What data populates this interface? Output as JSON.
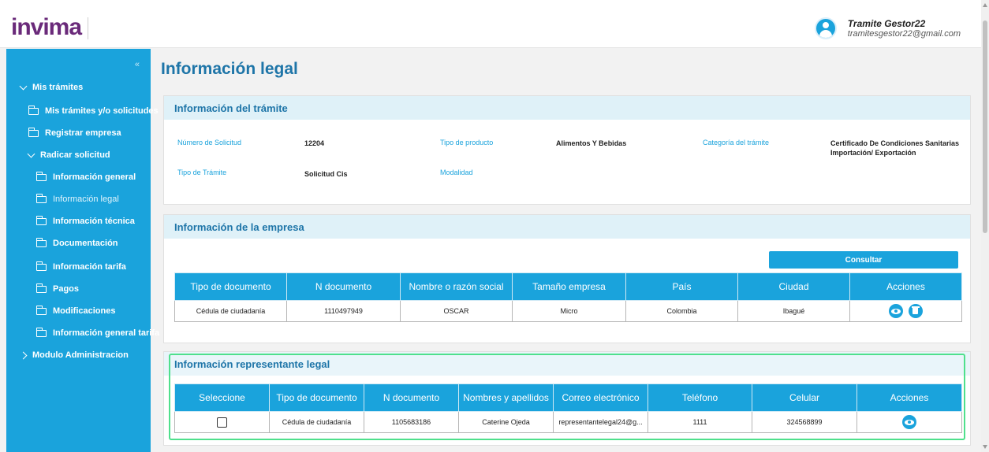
{
  "header": {
    "logo_text": "invima",
    "user_name": "Tramite Gestor22",
    "user_email": "tramitesgestor22@gmail.com"
  },
  "sidebar": {
    "collapse_icon": "double-chevron-left-icon",
    "items": [
      {
        "label": "Mis trámites"
      },
      {
        "label": "Mis trámites y/o solicitudes"
      },
      {
        "label": "Registrar empresa"
      },
      {
        "label": "Radicar solicitud"
      },
      {
        "label": "Información general"
      },
      {
        "label": "Información legal"
      },
      {
        "label": "Información técnica"
      },
      {
        "label": "Documentación"
      },
      {
        "label": "Información tarifa"
      },
      {
        "label": "Pagos"
      },
      {
        "label": "Modificaciones"
      },
      {
        "label": "Información general tarifa"
      },
      {
        "label": "Modulo Administracion"
      }
    ],
    "accent_color": "#1aa3dc"
  },
  "page": {
    "title": "Información legal"
  },
  "tramite": {
    "section_title": "Información del trámite",
    "numero_label": "Número de Solicitud",
    "numero_value": "12204",
    "tipo_producto_label": "Tipo de producto",
    "tipo_producto_value": "Alimentos Y Bebidas",
    "categoria_label": "Categoría del trámite",
    "categoria_value_line1": "Certificado De Condiciones Sanitarias",
    "categoria_value_line2": "Importación/ Exportación",
    "tipo_tramite_label": "Tipo de Trámite",
    "tipo_tramite_value": "Solicitud Cis",
    "modalidad_label": "Modalidad"
  },
  "empresa": {
    "section_title": "Información de la empresa",
    "consultar_label": "Consultar",
    "columns": [
      "Tipo de documento",
      "N documento",
      "Nombre o razón social",
      "Tamaño empresa",
      "País",
      "Ciudad",
      "Acciones"
    ],
    "rows": [
      {
        "tipo": "Cédula de ciudadanía",
        "numero": "1110497949",
        "nombre": "OSCAR",
        "tamano": "Micro",
        "pais": "Colombia",
        "ciudad": "Ibagué"
      }
    ]
  },
  "representante": {
    "section_title": "Información representante legal",
    "columns": [
      "Seleccione",
      "Tipo de documento",
      "N documento",
      "Nombres y apellidos",
      "Correo electrónico",
      "Teléfono",
      "Celular",
      "Acciones"
    ],
    "rows": [
      {
        "tipo": "Cédula de ciudadanía",
        "numero": "1105683186",
        "nombre": "Caterine Ojeda",
        "correo": "representantelegal24@g...",
        "telefono": "1111",
        "celular": "324568899"
      }
    ],
    "highlight_color": "#4fe08c"
  }
}
